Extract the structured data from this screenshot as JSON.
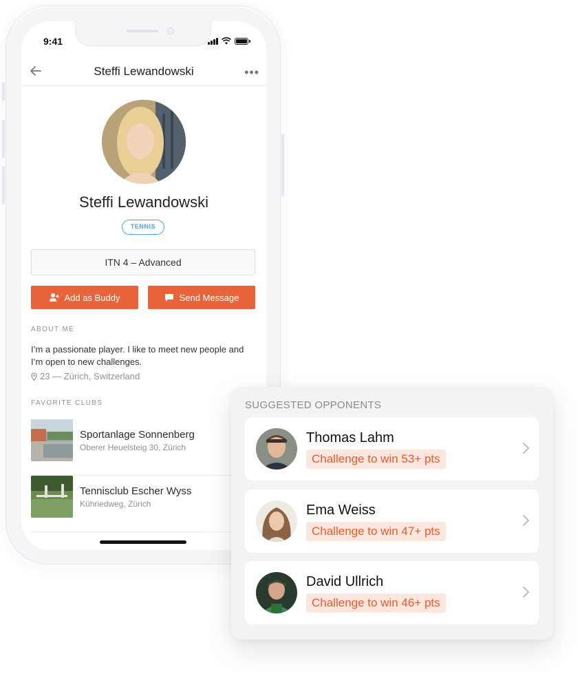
{
  "status_bar": {
    "time": "9:41"
  },
  "profile": {
    "nav_title": "Steffi Lewandowski",
    "name": "Steffi Lewandowski",
    "sport_tag": "TENNIS",
    "level": "ITN 4 – Advanced",
    "add_buddy_label": "Add as Buddy",
    "send_message_label": "Send Message",
    "about_label": "ABOUT ME",
    "about_text": "I’m a passionate player. I like to meet new people and I’m open to new challenges.",
    "location": "23 — Zürich, Switzerland",
    "clubs_label": "FAVORITE CLUBS",
    "clubs": [
      {
        "name": "Sportanlage Sonnenberg",
        "address": "Oberer Heuelsteig 30, Zürich"
      },
      {
        "name": "Tennisclub Escher Wyss",
        "address": "Kühriedweg, Zürich"
      }
    ]
  },
  "suggested": {
    "title": "SUGGESTED OPPONENTS",
    "opponents": [
      {
        "name": "Thomas Lahm",
        "challenge": "Challenge to win 53+ pts"
      },
      {
        "name": "Ema Weiss",
        "challenge": "Challenge to win 47+ pts"
      },
      {
        "name": "David Ullrich",
        "challenge": "Challenge to win 46+ pts"
      }
    ]
  },
  "colors": {
    "accent": "#e9633b",
    "tag_blue": "#4aa3df",
    "chip_bg": "#fde6de",
    "chip_text": "#ec5a2f"
  },
  "icons": {
    "back": "back-arrow-icon",
    "more": "more-dots-icon",
    "add_buddy": "add-person-icon",
    "message": "chat-bubble-icon",
    "location": "location-pin-icon",
    "chevron": "chevron-right-icon"
  }
}
